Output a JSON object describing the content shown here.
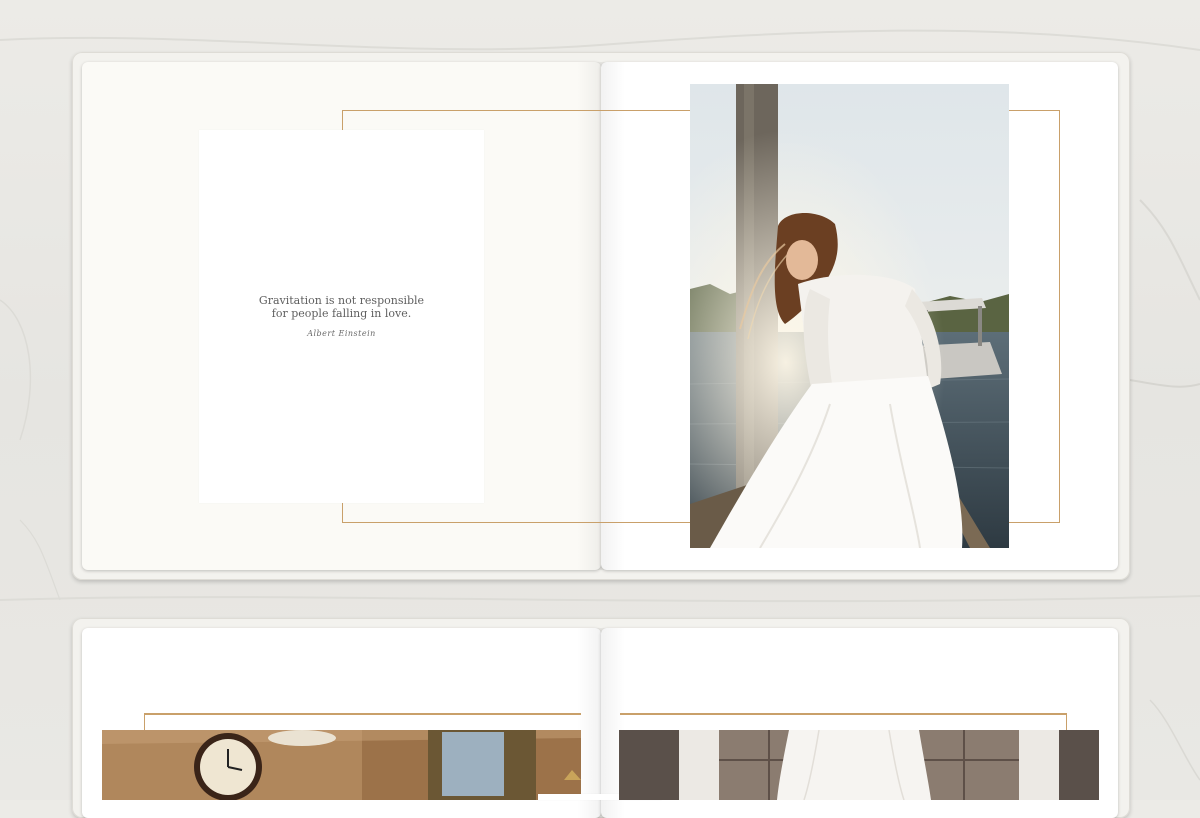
{
  "spread_one": {
    "quote_line1": "Gravitation is not responsible",
    "quote_line2": "for people falling in love.",
    "quote_author": "Albert Einstein",
    "photo_icon": "bride-on-dock-photo"
  },
  "spread_two": {
    "left_photo_icon": "wall-clock-room-photo",
    "right_photo_icon": "hanging-wedding-dress-photo"
  },
  "colors": {
    "accent_gold": "#c9a06a",
    "page_white": "#ffffff",
    "page_cream": "#fbfaf6",
    "background": "#e9e8e4"
  }
}
